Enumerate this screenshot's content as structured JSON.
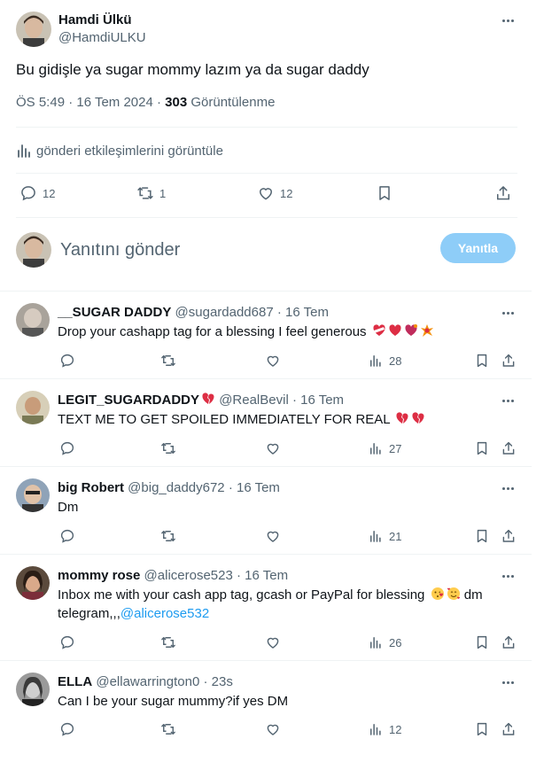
{
  "tweet": {
    "author_name": "Hamdi Ülkü",
    "author_handle": "@HamdiULKU",
    "text": "Bu gidişle ya sugar mommy lazım ya da sugar daddy",
    "time": "ÖS 5:49 · 16 Tem 2024 ·",
    "views_count": "303",
    "views_label": "Görüntülenme",
    "engagements_link": "gönderi etkileşimlerini görüntüle",
    "replies": "12",
    "retweets": "1",
    "likes": "12"
  },
  "reply_box": {
    "placeholder": "Yanıtını gönder",
    "button": "Yanıtla"
  },
  "replies": [
    {
      "name": "__SUGAR DADDY",
      "handle": "@sugardadd687",
      "time": "· 16 Tem",
      "text": "Drop your cashapp tag for a blessing I feel generous",
      "emojis": [
        "heart-bandaged",
        "red-heart",
        "heart-exclamation",
        "collision"
      ],
      "views": "28"
    },
    {
      "name": "LEGIT_SUGARDADDY",
      "name_emoji": "broken-heart",
      "handle": "@RealBevil",
      "time": "· 16 Tem",
      "text": "TEXT ME TO GET SPOILED IMMEDIATELY FOR REAL",
      "emojis": [
        "broken-heart",
        "broken-heart"
      ],
      "views": "27"
    },
    {
      "name": "big Robert",
      "handle": "@big_daddy672",
      "time": "· 16 Tem",
      "text": "Dm",
      "emojis": [],
      "views": "21"
    },
    {
      "name": "mommy rose",
      "handle": "@alicerose523",
      "time": "· 16 Tem",
      "text": "Inbox me with your cash app tag, gcash or PayPal for blessing",
      "emojis": [
        "kissing-face",
        "smiling-hearts"
      ],
      "text_after": "dm telegram,,,",
      "mention": "@alicerose532",
      "views": "26"
    },
    {
      "name": "ELLA",
      "handle": "@ellawarrington0",
      "time": "· 23s",
      "text": "Can I be your sugar mummy?if yes DM",
      "emojis": [],
      "views": "12"
    }
  ],
  "colors": {
    "accent": "#1d9bf0",
    "muted": "#536471",
    "reply_button": "#8ecdf8",
    "divider": "#eff3f4"
  }
}
